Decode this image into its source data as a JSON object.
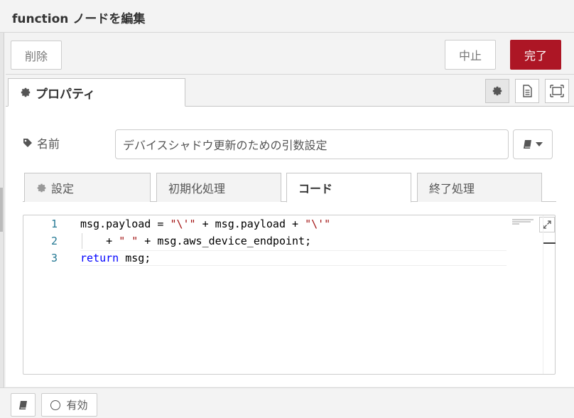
{
  "title": "function ノードを編集",
  "toolbar": {
    "delete_label": "削除",
    "cancel_label": "中止",
    "done_label": "完了"
  },
  "tabs": {
    "properties_label": "プロパティ"
  },
  "form": {
    "name_label": "名前",
    "name_value": "デバイスシャドウ更新のための引数設定"
  },
  "subtabs": [
    {
      "label": "設定"
    },
    {
      "label": "初期化処理"
    },
    {
      "label": "コード"
    },
    {
      "label": "終了処理"
    }
  ],
  "editor": {
    "lines": [
      {
        "num": "1",
        "tokens": [
          "msg.payload = ",
          "\"\\'\"",
          " + msg.payload + ",
          "\"\\'\""
        ]
      },
      {
        "num": "2",
        "tokens": [
          "    + ",
          "\" \"",
          " + msg.aws_device_endpoint;"
        ]
      },
      {
        "num": "3",
        "tokens": [
          "return",
          " msg;"
        ]
      }
    ]
  },
  "footer": {
    "enabled_label": "有効"
  },
  "colors": {
    "primary": "#ad1625",
    "string": "#a31515",
    "keyword": "#0000ff",
    "line_number": "#237893"
  }
}
